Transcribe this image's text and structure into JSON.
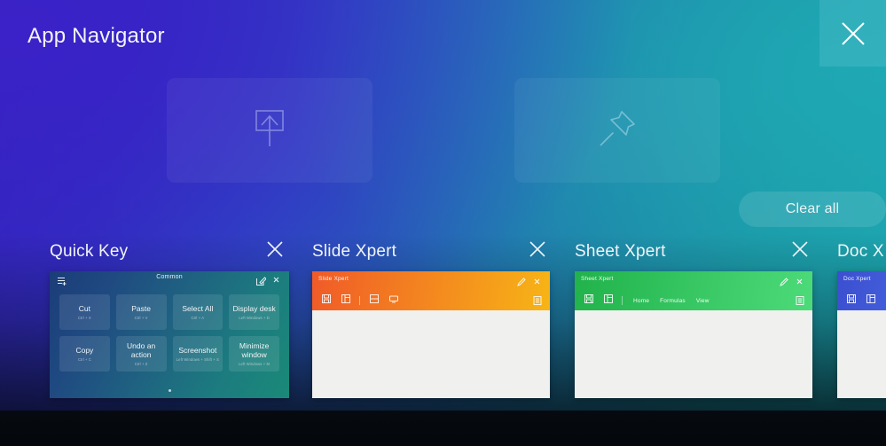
{
  "header": {
    "title": "App Navigator",
    "close_icon": "close-icon"
  },
  "drop_cards": [
    {
      "id": "share-to-screen",
      "icon": "share-to-screen-icon"
    },
    {
      "id": "pin",
      "icon": "pin-icon"
    }
  ],
  "clear_all": {
    "label": "Clear all"
  },
  "apps": [
    {
      "id": "quick-key",
      "name": "Quick Key",
      "close_icon": "close-icon",
      "thumb": {
        "kind": "quick-key",
        "header_title": "Common",
        "left_icon": "add-to-list-icon",
        "right_icons": [
          "edit-icon",
          "close-icon"
        ],
        "shortcuts": [
          {
            "label": "Cut",
            "keys": "Ctrl + X"
          },
          {
            "label": "Paste",
            "keys": "Ctrl + V"
          },
          {
            "label": "Select All",
            "keys": "Ctrl + A"
          },
          {
            "label": "Display desk",
            "keys": "Left Windows + D"
          },
          {
            "label": "Copy",
            "keys": "Ctrl + C"
          },
          {
            "label": "Undo an action",
            "keys": "Ctrl + Z"
          },
          {
            "label": "Screenshot",
            "keys": "Left Windows + Shift + S"
          },
          {
            "label": "Minimize window",
            "keys": "Left Windows + M"
          }
        ],
        "page_dot": "page-indicator-dot"
      }
    },
    {
      "id": "slide-xpert",
      "name": "Slide Xpert",
      "close_icon": "close-icon",
      "thumb": {
        "kind": "office",
        "header_title": "Slide Xpert",
        "accent_from": "#f05a28",
        "accent_to": "#f7b516",
        "toolbar_icons": [
          "save-icon",
          "layout-icon"
        ],
        "toolbar_icons_2": [
          "slide-icon",
          "present-icon"
        ],
        "menus": [],
        "right_icon": "menu-icon",
        "top_right_icons": [
          "pen-icon",
          "close-icon"
        ]
      }
    },
    {
      "id": "sheet-xpert",
      "name": "Sheet Xpert",
      "close_icon": "close-icon",
      "thumb": {
        "kind": "office",
        "header_title": "Sheet Xpert",
        "accent_from": "#21b24b",
        "accent_to": "#4ddb7a",
        "toolbar_icons": [
          "save-icon",
          "layout-icon"
        ],
        "toolbar_icons_2": [],
        "menus": [
          "Home",
          "Formulas",
          "View"
        ],
        "right_icon": "menu-icon",
        "top_right_icons": [
          "pen-icon",
          "close-icon"
        ]
      }
    },
    {
      "id": "doc-xpert",
      "name": "Doc X",
      "close_icon": null,
      "thumb": {
        "kind": "office",
        "header_title": "Doc Xpert",
        "accent_from": "#3b4fd0",
        "accent_to": "#4a6ae2",
        "toolbar_icons": [
          "save-icon",
          "layout-icon"
        ],
        "toolbar_icons_2": [],
        "menus": [],
        "right_icon": null,
        "top_right_icons": []
      }
    }
  ]
}
